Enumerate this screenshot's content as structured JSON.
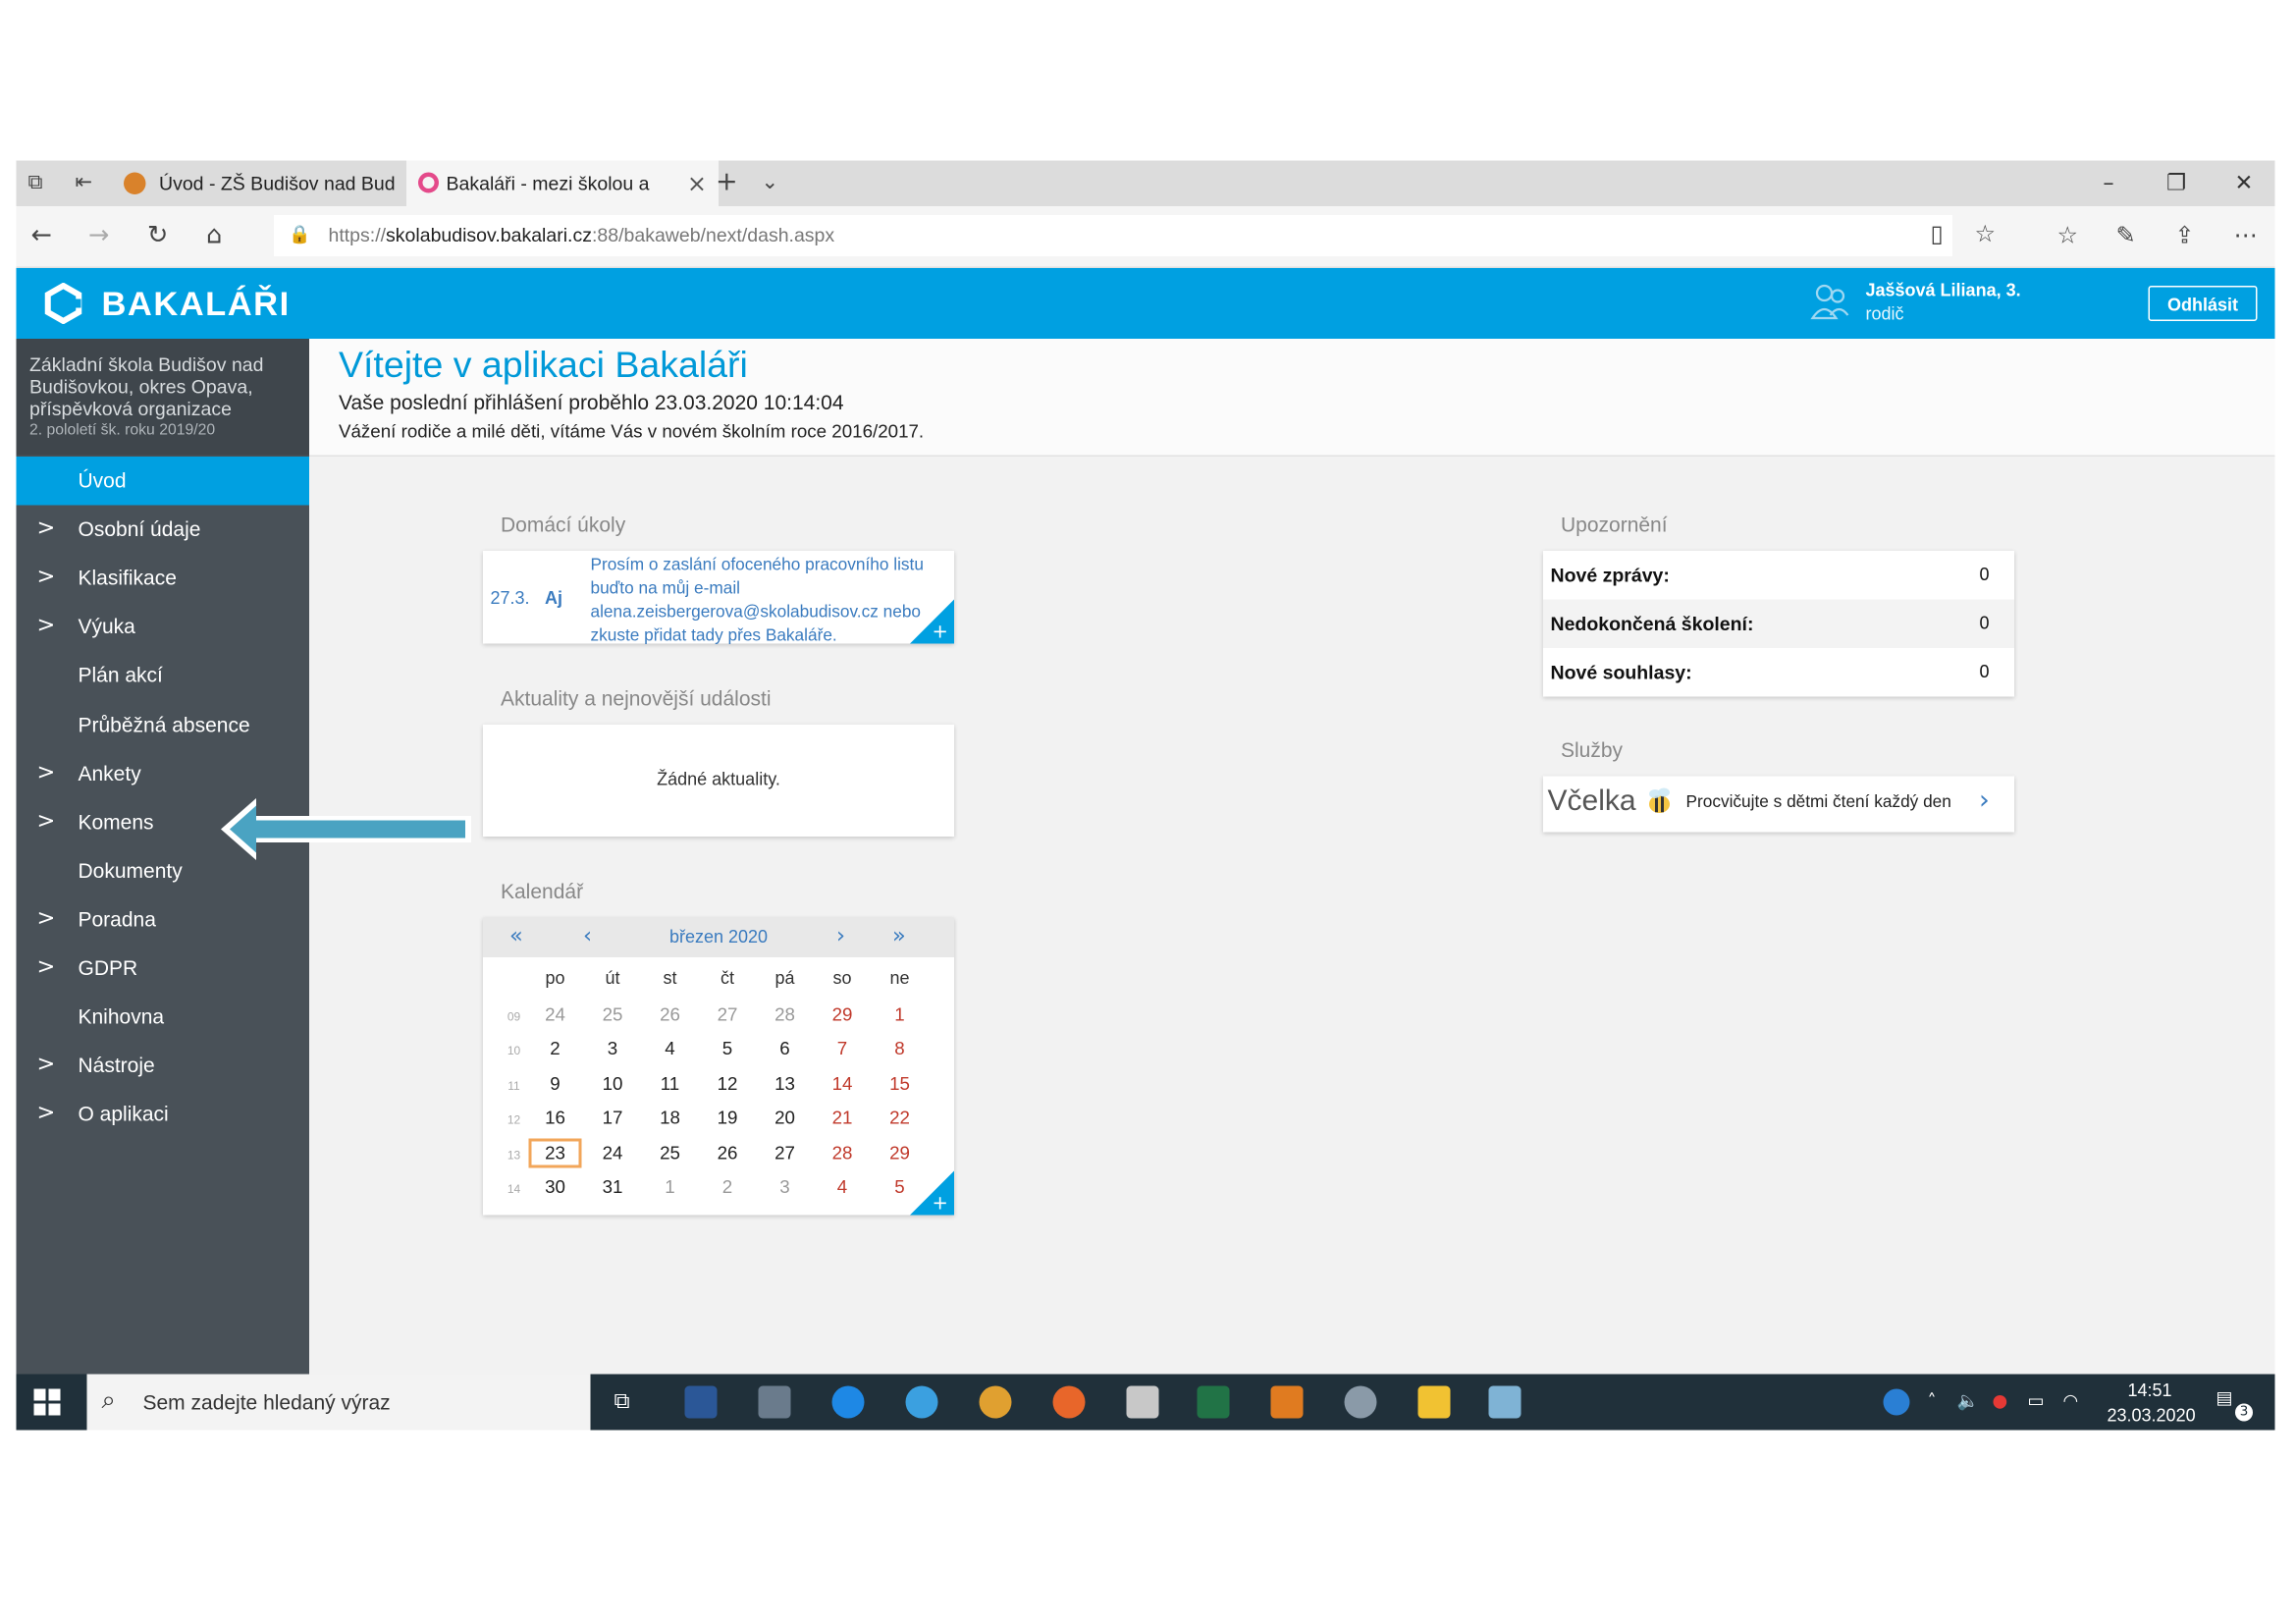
{
  "browser": {
    "tabs": [
      {
        "title": "Úvod - ZŠ Budišov nad Bud"
      },
      {
        "title": "Bakaláři - mezi školou a"
      }
    ],
    "url_prefix": "https://",
    "url_host": "skolabudisov.bakalari.cz",
    "url_rest": ":88/bakaweb/next/dash.aspx"
  },
  "header": {
    "app_name": "BAKALÁŘI",
    "user_name": "Jaššová Liliana, 3.",
    "user_role": "rodič",
    "logout_label": "Odhlásit",
    "accent_color": "#00a0e1"
  },
  "sidebar": {
    "school_name": "Základní škola Budišov nad Budišovkou, okres Opava, příspěvková organizace",
    "term": "2. pololetí šk. roku 2019/20",
    "items": [
      {
        "label": "Úvod",
        "expandable": false,
        "active": true
      },
      {
        "label": "Osobní údaje",
        "expandable": true
      },
      {
        "label": "Klasifikace",
        "expandable": true
      },
      {
        "label": "Výuka",
        "expandable": true
      },
      {
        "label": "Plán akcí",
        "expandable": false
      },
      {
        "label": "Průběžná absence",
        "expandable": false
      },
      {
        "label": "Ankety",
        "expandable": true
      },
      {
        "label": "Komens",
        "expandable": true
      },
      {
        "label": "Dokumenty",
        "expandable": false
      },
      {
        "label": "Poradna",
        "expandable": true
      },
      {
        "label": "GDPR",
        "expandable": true
      },
      {
        "label": "Knihovna",
        "expandable": false
      },
      {
        "label": "Nástroje",
        "expandable": true
      },
      {
        "label": "O aplikaci",
        "expandable": true
      }
    ]
  },
  "welcome": {
    "title": "Vítejte v aplikaci Bakaláři",
    "last_login": "Vaše poslední přihlášení proběhlo 23.03.2020 10:14:04",
    "greeting": "Vážení rodiče a milé děti, vítáme Vás v novém školním roce 2016/2017."
  },
  "homework": {
    "title": "Domácí úkoly",
    "date": "27.3.",
    "subject": "Aj",
    "text": "Prosím o zaslání ofoceného pracovního listu buďto na můj e-mail alena.zeisbergerova@skolabudisov.cz nebo zkuste přidat tady přes Bakaláře."
  },
  "news": {
    "title": "Aktuality a nejnovější události",
    "empty": "Žádné aktuality."
  },
  "calendar": {
    "title": "Kalendář",
    "month": "březen 2020",
    "nav": {
      "first": "«",
      "prev": "‹",
      "next": "›",
      "last": "»"
    },
    "weekdays": [
      "po",
      "út",
      "st",
      "čt",
      "pá",
      "so",
      "ne"
    ],
    "weeks": [
      {
        "wk": "09",
        "days": [
          "24",
          "25",
          "26",
          "27",
          "28",
          "29",
          "1"
        ],
        "other": [
          true,
          true,
          true,
          true,
          true,
          true,
          false
        ]
      },
      {
        "wk": "10",
        "days": [
          "2",
          "3",
          "4",
          "5",
          "6",
          "7",
          "8"
        ],
        "other": [
          false,
          false,
          false,
          false,
          false,
          false,
          false
        ]
      },
      {
        "wk": "11",
        "days": [
          "9",
          "10",
          "11",
          "12",
          "13",
          "14",
          "15"
        ],
        "other": [
          false,
          false,
          false,
          false,
          false,
          false,
          false
        ]
      },
      {
        "wk": "12",
        "days": [
          "16",
          "17",
          "18",
          "19",
          "20",
          "21",
          "22"
        ],
        "other": [
          false,
          false,
          false,
          false,
          false,
          false,
          false
        ]
      },
      {
        "wk": "13",
        "days": [
          "23",
          "24",
          "25",
          "26",
          "27",
          "28",
          "29"
        ],
        "other": [
          false,
          false,
          false,
          false,
          false,
          false,
          false
        ]
      },
      {
        "wk": "14",
        "days": [
          "30",
          "31",
          "1",
          "2",
          "3",
          "4",
          "5"
        ],
        "other": [
          false,
          false,
          true,
          true,
          true,
          true,
          true
        ]
      }
    ],
    "today": "23"
  },
  "notifications": {
    "title": "Upozornění",
    "rows": [
      {
        "label": "Nové zprávy:",
        "value": "0"
      },
      {
        "label": "Nedokončená školení:",
        "value": "0"
      },
      {
        "label": "Nové souhlasy:",
        "value": "0"
      }
    ]
  },
  "services": {
    "title": "Služby",
    "vcelka_name": "Včelka",
    "vcelka_text": "Procvičujte s dětmi čtení každý den"
  },
  "taskbar": {
    "search_placeholder": "Sem zadejte hledaný výraz",
    "time": "14:51",
    "date": "23.03.2020",
    "notification_count": "3"
  }
}
